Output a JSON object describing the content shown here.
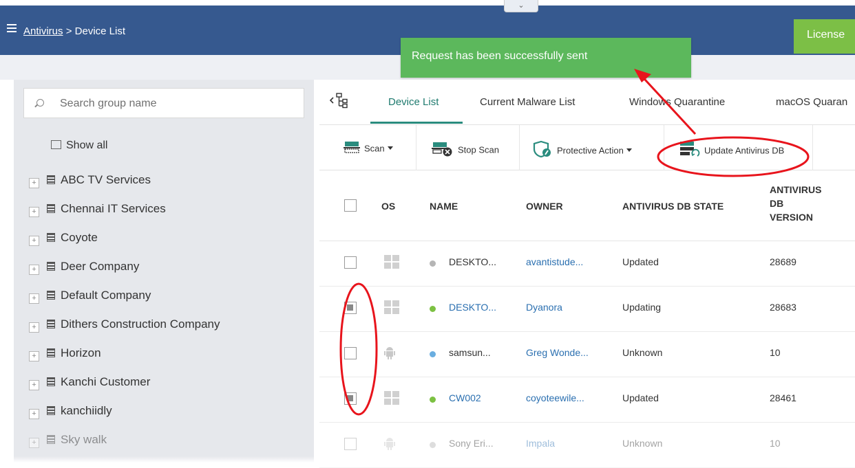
{
  "header": {
    "breadcrumb_link": "Antivirus",
    "breadcrumb_sep": " > ",
    "breadcrumb_current": "Device List",
    "license_label": "License",
    "bg_color": "#36598f"
  },
  "notification": {
    "text": "Request has been successfully sent",
    "color": "#5cb85c"
  },
  "sidebar": {
    "search_placeholder": "Search group name",
    "show_all_label": "Show all",
    "groups": [
      {
        "label": "ABC TV Services"
      },
      {
        "label": "Chennai IT Services"
      },
      {
        "label": "Coyote"
      },
      {
        "label": "Deer Company"
      },
      {
        "label": "Default Company"
      },
      {
        "label": "Dithers Construction Company"
      },
      {
        "label": "Horizon"
      },
      {
        "label": "Kanchi Customer"
      },
      {
        "label": "kanchiidly"
      },
      {
        "label": "Sky walk"
      }
    ]
  },
  "tabs": [
    {
      "label": "Device List",
      "active": true
    },
    {
      "label": "Current Malware List"
    },
    {
      "label": "Windows Quarantine"
    },
    {
      "label": "macOS Quaran"
    }
  ],
  "toolbar": {
    "scan_label": "Scan",
    "stop_scan_label": "Stop Scan",
    "protective_action_label": "Protective Action",
    "update_db_label": "Update Antivirus DB"
  },
  "table": {
    "headers": {
      "os": "OS",
      "name": "NAME",
      "owner": "OWNER",
      "db_state": "ANTIVIRUS DB STATE",
      "db_version_1": "ANTIVIRUS",
      "db_version_2": "DB",
      "db_version_3": "VERSION"
    },
    "rows": [
      {
        "os": "windows",
        "status": "grey",
        "name": "DESKTO...",
        "owner": "avantistude...",
        "state": "Updated",
        "version": "28689",
        "checked": false
      },
      {
        "os": "windows",
        "status": "green",
        "name": "DESKTO...",
        "owner": "Dyanora",
        "state": "Updating",
        "version": "28683",
        "checked": true
      },
      {
        "os": "android",
        "status": "blue",
        "name": "samsun...",
        "owner": "Greg Wonde...",
        "state": "Unknown",
        "version": "10",
        "checked": false
      },
      {
        "os": "windows",
        "status": "green",
        "name": "CW002",
        "owner": "coyoteewile...",
        "state": "Updated",
        "version": "28461",
        "checked": true
      },
      {
        "os": "android",
        "status": "grey",
        "name": "Sony Eri...",
        "owner": "Impala",
        "state": "Unknown",
        "version": "10",
        "checked": false
      }
    ]
  },
  "status_colors": {
    "grey": "#b5b5b5",
    "green": "#7cc142",
    "blue": "#6aaee0"
  }
}
